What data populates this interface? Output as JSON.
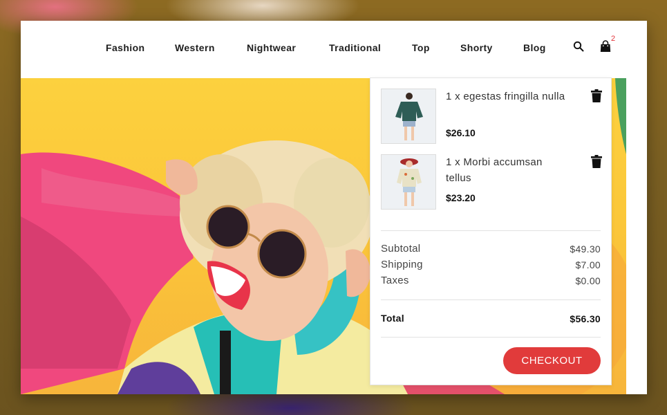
{
  "nav": {
    "items": [
      {
        "label": "Fashion"
      },
      {
        "label": "Western"
      },
      {
        "label": "Nightwear"
      },
      {
        "label": "Traditional"
      },
      {
        "label": "Top"
      },
      {
        "label": "Shorty"
      },
      {
        "label": "Blog"
      }
    ]
  },
  "header": {
    "search_icon": "search-icon",
    "cart_icon": "shopping-bag-icon",
    "cart_count": "2"
  },
  "cart": {
    "items": [
      {
        "name": "1 x egestas fringilla nulla",
        "price": "$26.10",
        "image": "green-top-model-photo"
      },
      {
        "name": "1 x Morbi accumsan tellus",
        "price": "$23.20",
        "image": "floral-top-model-photo"
      }
    ],
    "summary": {
      "subtotal_label": "Subtotal",
      "subtotal_value": "$49.30",
      "shipping_label": "Shipping",
      "shipping_value": "$7.00",
      "taxes_label": "Taxes",
      "taxes_value": "$0.00",
      "total_label": "Total",
      "total_value": "$56.30"
    },
    "checkout_label": "CHECKOUT"
  },
  "colors": {
    "accent": "#e13b3b",
    "hero_background": "#fbc73a",
    "page_backdrop": "#7a5f22"
  }
}
